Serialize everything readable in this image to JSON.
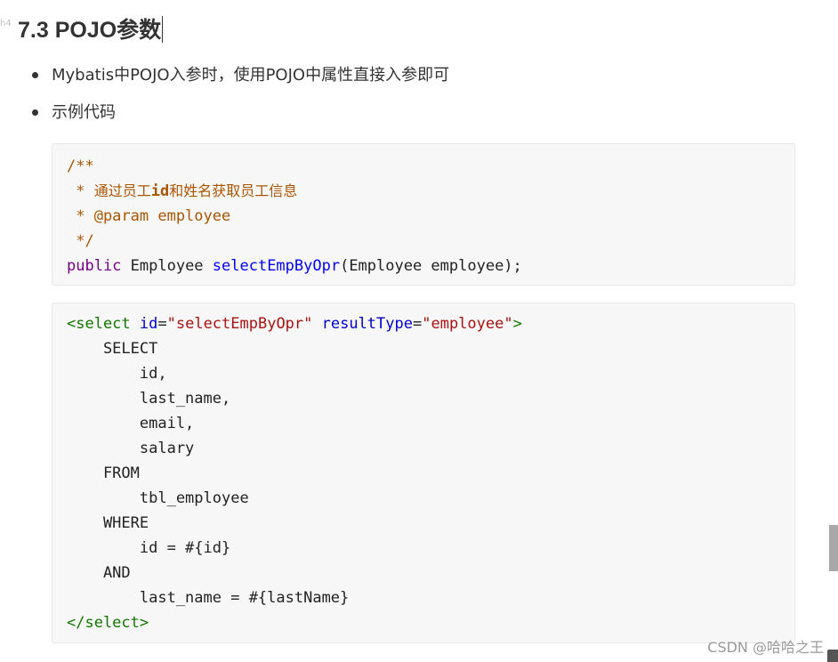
{
  "heading": {
    "marker": "h4",
    "title": "7.3 POJO参数"
  },
  "bullets": [
    "Mybatis中POJO入参时，使用POJO中属性直接入参即可",
    "示例代码"
  ],
  "code_java": {
    "comment_open": "/**",
    "comment_desc_prefix": " * ",
    "comment_desc_a": "通过员工",
    "comment_desc_id": "id",
    "comment_desc_b": "和姓名获取员工信息",
    "comment_param": " * @param employee",
    "comment_close": " */",
    "kw_public": "public",
    "type_employee": " Employee ",
    "method_name": "selectEmpByOpr",
    "method_args": "(Employee employee);"
  },
  "code_xml": {
    "tag_open": "<select",
    "attr_id": " id",
    "eq1": "=",
    "val_id": "\"selectEmpByOpr\"",
    "attr_result": " resultType",
    "eq2": "=",
    "val_result": "\"employee\"",
    "tag_open_end": ">",
    "lines": [
      "    SELECT",
      "        id,",
      "        last_name,",
      "        email,",
      "        salary",
      "    FROM",
      "        tbl_employee",
      "    WHERE",
      "        id = #{id}",
      "    AND",
      "        last_name = #{lastName}"
    ],
    "tag_close": "</select>"
  },
  "watermark": "CSDN @哈哈之王"
}
